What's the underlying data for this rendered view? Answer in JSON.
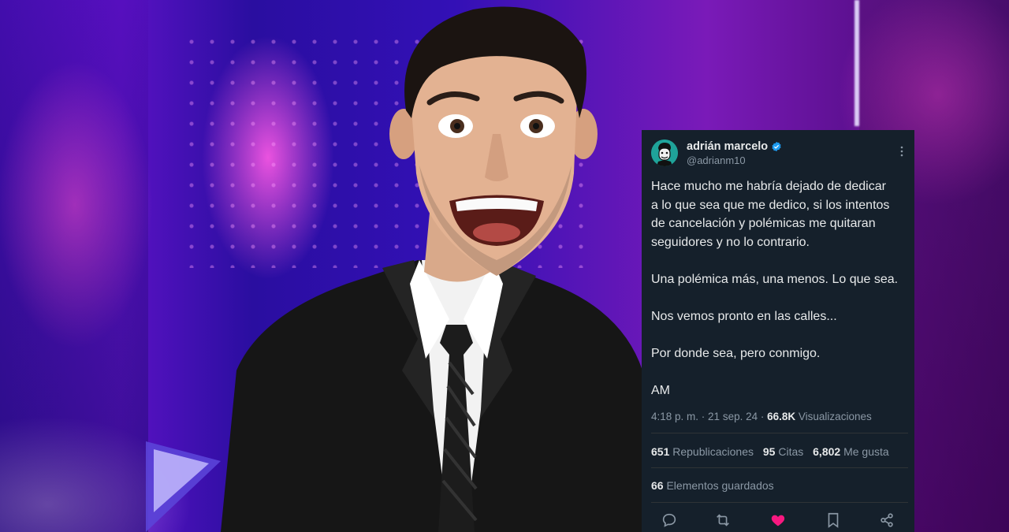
{
  "tweet": {
    "author_name": "adrián marcelo",
    "handle": "@adrianm10",
    "paragraphs": [
      "Hace mucho me habría dejado de dedicar\na lo que sea que me dedico, si los intentos\nde cancelación y polémicas me quitaran\nseguidores y no lo contrario.",
      "Una polémica más, una menos. Lo que sea.",
      "Nos vemos pronto en las calles...",
      "Por donde sea, pero conmigo.",
      "AM"
    ],
    "time": "4:18 p. m.",
    "date": "21 sep. 24",
    "views_count": "66.8K",
    "views_label": "Visualizaciones",
    "reposts_count": "651",
    "reposts_label": "Republicaciones",
    "quotes_count": "95",
    "quotes_label": "Citas",
    "likes_count": "6,802",
    "likes_label": "Me gusta",
    "bookmarks_count": "66",
    "bookmarks_label": "Elementos guardados",
    "icons": [
      "reply-icon",
      "retweet-icon",
      "like-icon",
      "bookmark-icon",
      "share-icon",
      "more-icon",
      "verified-icon"
    ],
    "colors": {
      "card_bg": "#15202b",
      "like": "#f91880",
      "verified": "#1d9bf0",
      "muted": "#8b98a5"
    }
  }
}
